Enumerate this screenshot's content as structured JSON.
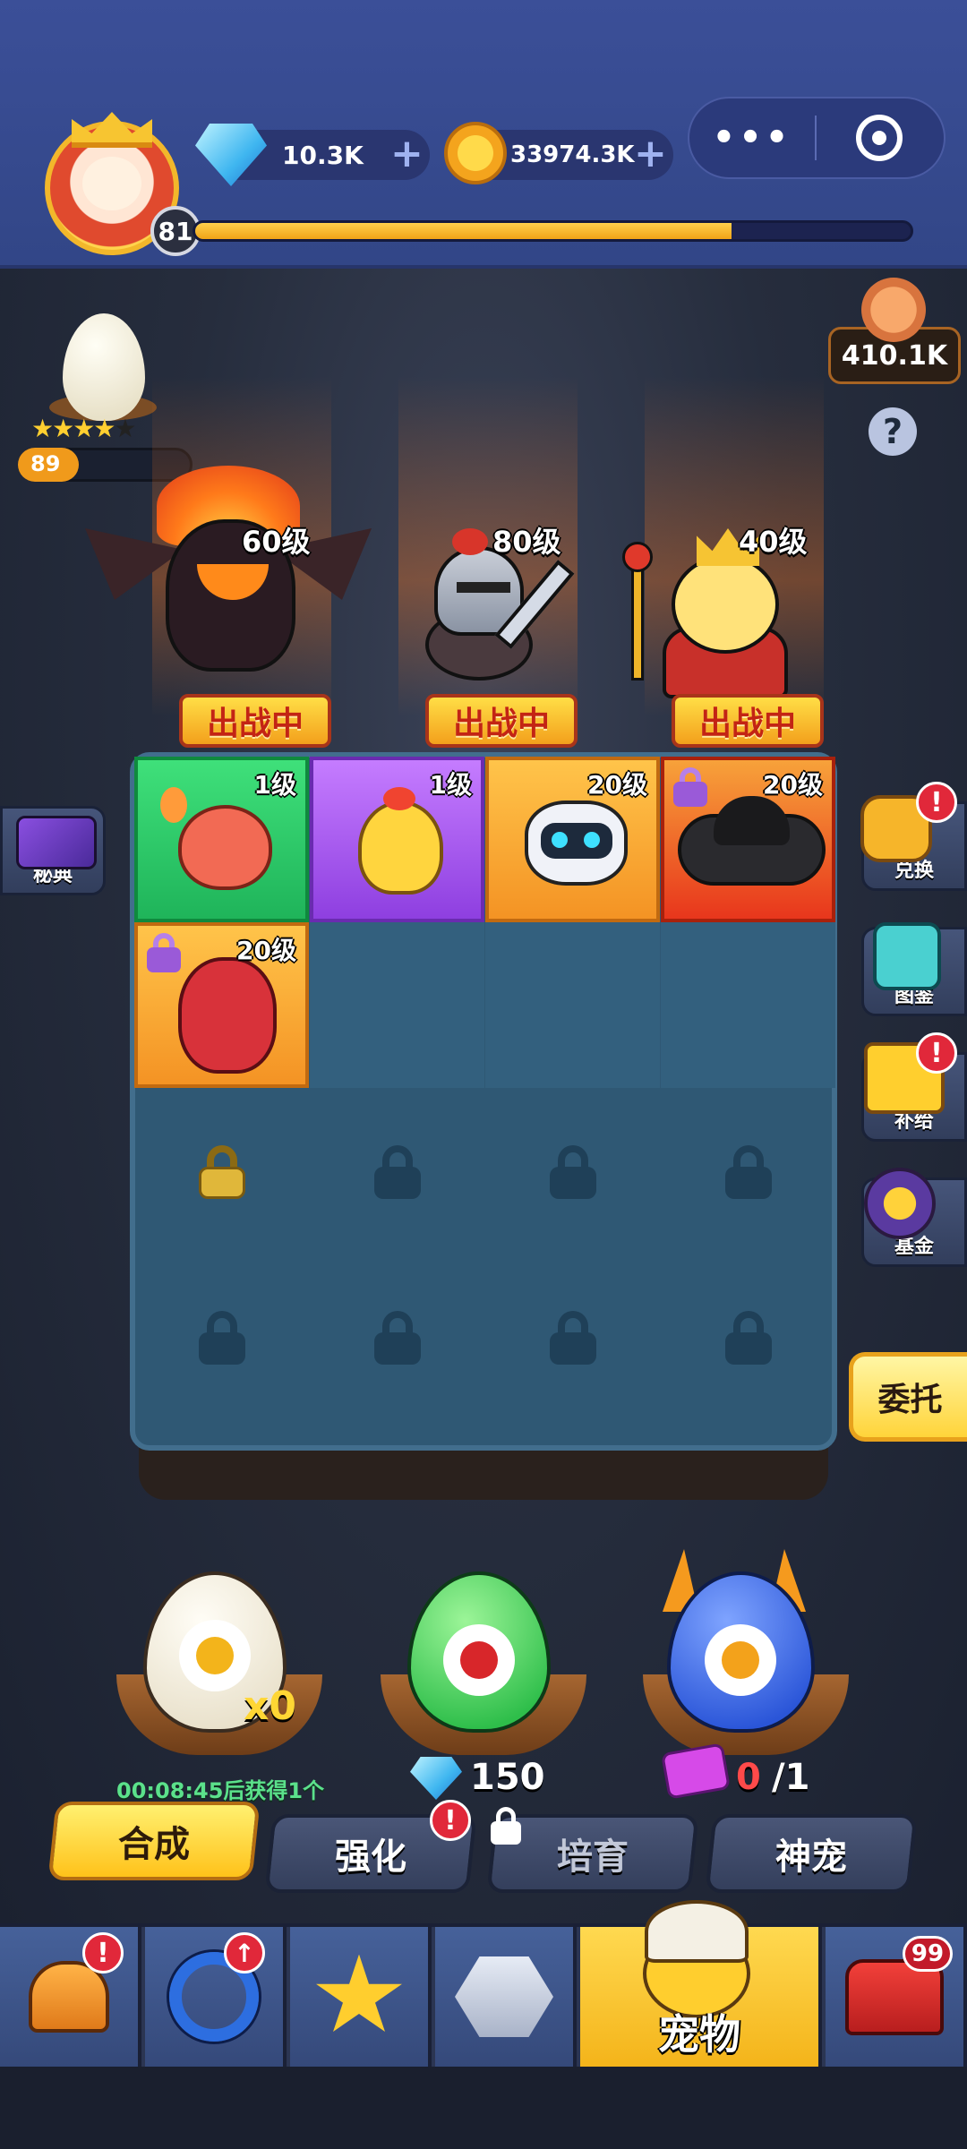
{
  "header": {
    "player_level": "81",
    "xp_progress_fraction": 0.75,
    "gems": "10.3K",
    "coins": "33974.3K",
    "menu_more": "•••",
    "plus": "+"
  },
  "side_top": {
    "cookie_value": "410.1K",
    "help": "?",
    "egg_stars_filled": 4,
    "egg_stars_total": 5,
    "egg_stars": "★★★★★",
    "egg_level": "89",
    "egg_progress_fraction": 0.35
  },
  "heroes": [
    {
      "level": "60级",
      "badge": "出战中"
    },
    {
      "level": "80级",
      "badge": "出战中"
    },
    {
      "level": "40级",
      "badge": "出战中"
    }
  ],
  "pets": [
    {
      "level": "1级"
    },
    {
      "level": "1级"
    },
    {
      "level": "20级"
    },
    {
      "level": "20级"
    },
    {
      "level": "20级"
    }
  ],
  "side_buttons": {
    "secret_book": "秘典",
    "exchange": "兑换",
    "gallery": "图鉴",
    "supply": "补给",
    "fund": "基金",
    "entrust": "委托",
    "badge": "!"
  },
  "eggs": {
    "white_count": "x0",
    "timer": "00:08:45后获得1个",
    "green_cost": "150",
    "blue_ticket_count": "0",
    "blue_ticket_max": "/1"
  },
  "tabs": {
    "merge": "合成",
    "enhance": "强化",
    "breed": "培育",
    "divine_pet": "神宠"
  },
  "bottom_nav": {
    "pets_label": "宠物",
    "chest_count": "99"
  },
  "colors": {
    "accent_yellow": "#ffc21a",
    "header_blue": "#3b4f98",
    "alert_red": "#e1283a"
  }
}
